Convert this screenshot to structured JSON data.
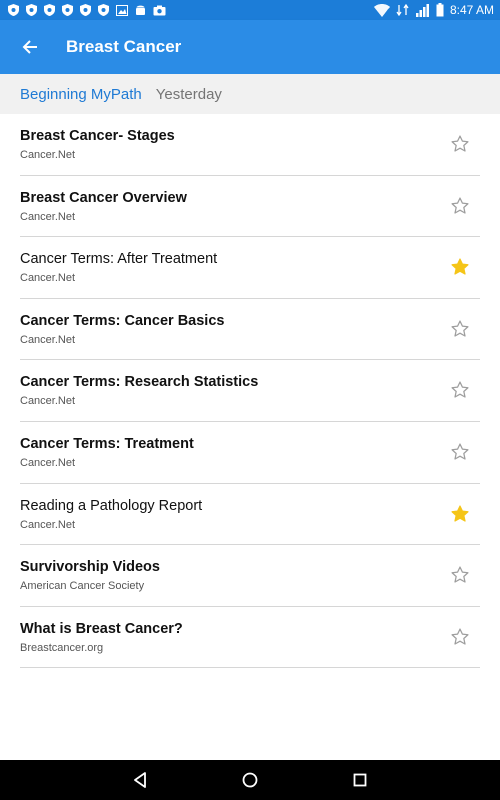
{
  "status_bar": {
    "time": "8:47 AM",
    "icons": [
      "shield-icon",
      "shield-icon",
      "shield-icon",
      "shield-icon",
      "shield-icon",
      "shield-icon",
      "image-icon",
      "android-icon",
      "photo-icon",
      "wifi-icon",
      "signal-icon",
      "battery-icon"
    ]
  },
  "app_bar": {
    "title": "Breast Cancer",
    "back_icon": "back-arrow-icon"
  },
  "breadcrumb": {
    "link": "Beginning MyPath",
    "current": "Yesterday"
  },
  "items": [
    {
      "title": "Breast Cancer- Stages",
      "source": "Cancer.Net",
      "starred": false,
      "bold": true
    },
    {
      "title": "Breast Cancer Overview",
      "source": "Cancer.Net",
      "starred": false,
      "bold": true
    },
    {
      "title": "Cancer Terms: After Treatment",
      "source": "Cancer.Net",
      "starred": true,
      "bold": false
    },
    {
      "title": "Cancer Terms: Cancer Basics",
      "source": "Cancer.Net",
      "starred": false,
      "bold": true
    },
    {
      "title": "Cancer Terms: Research Statistics",
      "source": "Cancer.Net",
      "starred": false,
      "bold": true
    },
    {
      "title": "Cancer Terms: Treatment",
      "source": "Cancer.Net",
      "starred": false,
      "bold": true
    },
    {
      "title": "Reading a Pathology Report",
      "source": "Cancer.Net",
      "starred": true,
      "bold": false
    },
    {
      "title": "Survivorship Videos",
      "source": "American Cancer Society",
      "starred": false,
      "bold": true
    },
    {
      "title": "What is Breast Cancer?",
      "source": "Breastcancer.org",
      "starred": false,
      "bold": true
    }
  ],
  "colors": {
    "status_bar": "#1c7dd8",
    "app_bar": "#2b8ce6",
    "link": "#1f7ad4",
    "star_filled": "#f5c518",
    "star_empty": "#9e9e9e"
  },
  "nav_bar": {
    "icons": [
      "back-triangle-icon",
      "home-circle-icon",
      "recents-square-icon"
    ]
  }
}
